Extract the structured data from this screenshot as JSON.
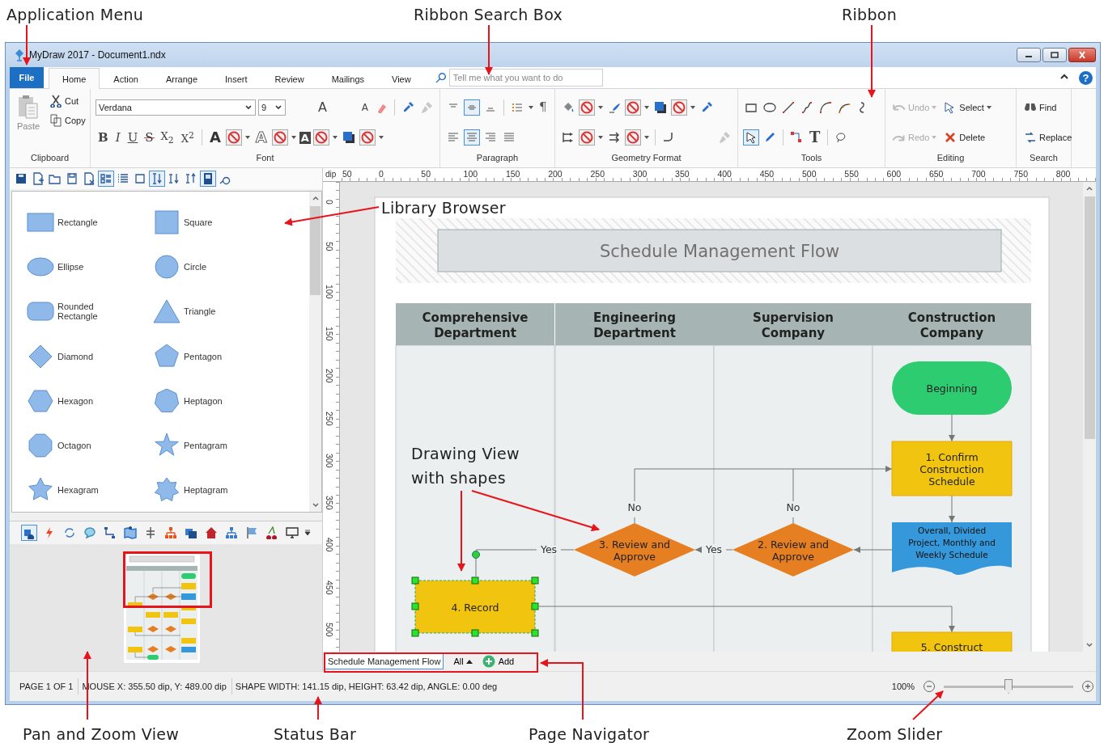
{
  "callouts": [
    {
      "label": "Application Menu"
    },
    {
      "label": "Ribbon Search Box"
    },
    {
      "label": "Ribbon"
    },
    {
      "label": "Library Browser"
    },
    {
      "label": "Drawing View with shapes"
    },
    {
      "label": "Pan and Zoom View"
    },
    {
      "label": "Status Bar"
    },
    {
      "label": "Page Navigator"
    },
    {
      "label": "Zoom Slider"
    }
  ],
  "window": {
    "title": "MyDraw 2017 - Document1.ndx"
  },
  "file_menu": {
    "label": "File"
  },
  "tabs": [
    {
      "label": "Home",
      "selected": true
    },
    {
      "label": "Action",
      "selected": false
    },
    {
      "label": "Arrange",
      "selected": false
    },
    {
      "label": "Insert",
      "selected": false
    },
    {
      "label": "Review",
      "selected": false
    },
    {
      "label": "Mailings",
      "selected": false
    },
    {
      "label": "View",
      "selected": false
    }
  ],
  "search": {
    "placeholder": "Tell me what you want to do"
  },
  "help": "?",
  "ribbon": {
    "clipboard": {
      "paste": "Paste",
      "cut": "Cut",
      "copy": "Copy",
      "label": "Clipboard"
    },
    "font": {
      "family": "Verdana",
      "size": "9",
      "size_glyphs": [
        {
          "glyph": "A",
          "kind": "grow"
        },
        {
          "glyph": "A",
          "kind": "shrink"
        }
      ],
      "format": [
        {
          "glyph": "B",
          "kind": "bold"
        },
        {
          "glyph": "I",
          "kind": "italic"
        },
        {
          "glyph": "U",
          "kind": "underline"
        },
        {
          "glyph": "S",
          "kind": "strike"
        },
        {
          "glyph": "X$_{2}$",
          "kind": "sub"
        },
        {
          "glyph": "X$^{2}$",
          "kind": "sup"
        }
      ],
      "colors": [
        {
          "glyph": "A",
          "kind": "fill"
        },
        {
          "glyph": "A",
          "kind": "outline"
        },
        {
          "glyph": "A",
          "kind": "inverse"
        }
      ],
      "label": "Font"
    },
    "paragraph": {
      "pilcrow": "¶",
      "label": "Paragraph"
    },
    "geometry": {
      "label": "Geometry Format"
    },
    "tools": {
      "text_tool": "T",
      "label": "Tools"
    },
    "editing": {
      "undo": {
        "label": "Undo",
        "disabled": true
      },
      "redo": {
        "label": "Redo",
        "disabled": true
      },
      "select": {
        "label": "Select",
        "disabled": false
      },
      "delete": {
        "label": "Delete",
        "disabled": false
      },
      "label": "Editing"
    },
    "search": {
      "find": "Find",
      "replace": "Replace",
      "label": "Search"
    }
  },
  "library": {
    "items": [
      {
        "label": "Rectangle",
        "kind": "rectangle"
      },
      {
        "label": "Square",
        "kind": "square"
      },
      {
        "label": "Ellipse",
        "kind": "ellipse"
      },
      {
        "label": "Circle",
        "kind": "circle"
      },
      {
        "label": "Rounded Rectangle",
        "kind": "rounded"
      },
      {
        "label": "Triangle",
        "kind": "triangle"
      },
      {
        "label": "Diamond",
        "kind": "diamond"
      },
      {
        "label": "Pentagon",
        "kind": "pentagon"
      },
      {
        "label": "Hexagon",
        "kind": "hexagon"
      },
      {
        "label": "Heptagon",
        "kind": "heptagon"
      },
      {
        "label": "Octagon",
        "kind": "octagon"
      },
      {
        "label": "Pentagram",
        "kind": "pentagram"
      },
      {
        "label": "Hexagram",
        "kind": "hexagram"
      },
      {
        "label": "Heptagram",
        "kind": "heptagram"
      }
    ]
  },
  "ruler": {
    "unit": "dip",
    "h": [
      "50",
      "0",
      "50",
      "100",
      "150",
      "200",
      "250",
      "300",
      "350",
      "400",
      "450",
      "500",
      "550",
      "600",
      "650",
      "700",
      "750",
      "800"
    ],
    "v": [
      "0",
      "50",
      "100",
      "150",
      "200",
      "250",
      "300",
      "350",
      "400",
      "450",
      "500"
    ]
  },
  "diagram": {
    "title": "Schedule Management Flow",
    "lanes": [
      {
        "lines": [
          "Comprehensive",
          "Department"
        ]
      },
      {
        "lines": [
          "Engineering",
          "Department"
        ]
      },
      {
        "lines": [
          "Supervision",
          "Company"
        ]
      },
      {
        "lines": [
          "Construction",
          "Company"
        ]
      }
    ],
    "nodes": [
      {
        "kind": "terminator",
        "lines": [
          "Beginning"
        ],
        "selected": false
      },
      {
        "kind": "process",
        "lines": [
          "1. Confirm",
          "Construction",
          "Schedule"
        ],
        "selected": false
      },
      {
        "kind": "decision",
        "lines": [
          "3. Review and",
          "Approve"
        ],
        "selected": false
      },
      {
        "kind": "decision",
        "lines": [
          "2. Review and",
          "Approve"
        ],
        "selected": false
      },
      {
        "kind": "document",
        "lines": [
          "Overall, Divided",
          "Project, Monthly and",
          "Weekly Schedule"
        ],
        "selected": false
      },
      {
        "kind": "process",
        "lines": [
          "4. Record"
        ],
        "selected": true
      },
      {
        "kind": "process",
        "lines": [
          "5. Construct"
        ],
        "selected": false
      }
    ],
    "edge_labels": [
      "No",
      "No",
      "Yes",
      "Yes"
    ]
  },
  "page_navigator": {
    "pages": [
      {
        "label": "Schedule Management Flow",
        "selected": true
      }
    ],
    "filter": "All",
    "add": "Add"
  },
  "status_bar": {
    "page": "PAGE 1 OF 1",
    "mouse": "MOUSE X: 355.50 dip, Y: 489.00 dip",
    "shape": "SHAPE WIDTH: 141.15 dip, HEIGHT: 63.42 dip, ANGLE: 0.00 deg",
    "zoom": "100%"
  },
  "zoom_slider": {
    "level": 0.5
  }
}
